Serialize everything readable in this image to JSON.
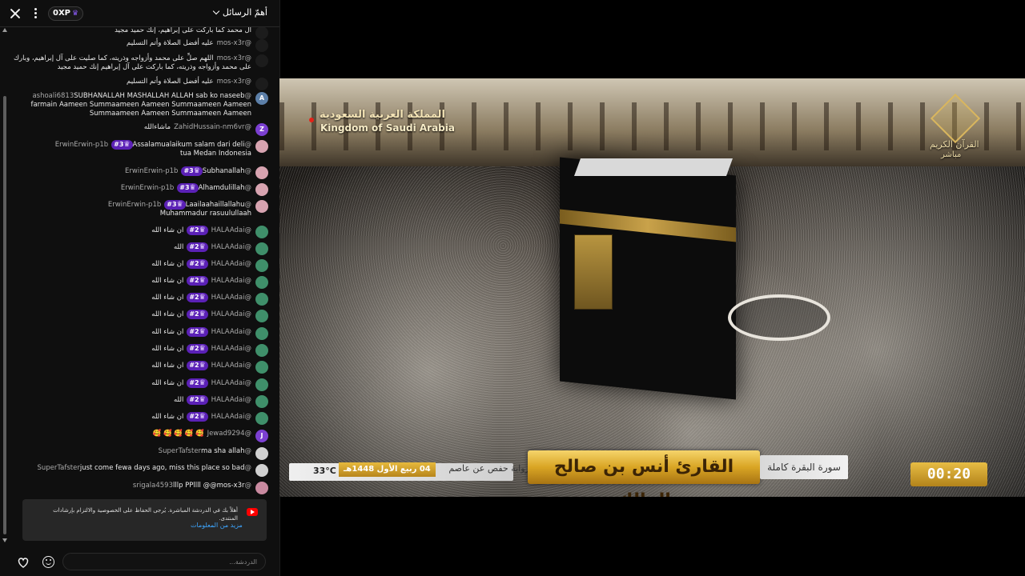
{
  "header": {
    "xp_label": "0XP",
    "mode_label": "أهمّ الرسائل"
  },
  "messages": [
    {
      "author": "",
      "text": "آل محمد كما باركت على إبراهيم، إنك حميد مجيد",
      "avatar_color": "#1c1c1c",
      "avatar_letter": ""
    },
    {
      "author": "@mos-x3r",
      "text": "عليه أفضل الصلاة وأتم التسليم",
      "avatar_color": "#1c1c1c",
      "avatar_letter": ""
    },
    {
      "author": "@mos-x3r",
      "text": "اللهم صلِّ على محمد وأزواجه وذريته، كما صليت على آل إبراهيم، وبارك على محمد وأزواجه وذريته، كما باركت على آل إبراهيم إنك حميد مجيد",
      "avatar_color": "#1c1c1c",
      "avatar_letter": ""
    },
    {
      "author": "@mos-x3r",
      "text": "عليه أفضل الصلاة وأتم التسليم",
      "avatar_color": "#1c1c1c",
      "avatar_letter": ""
    },
    {
      "author": "@ashoali6813",
      "text": "SUBHANALLAH MASHALLAH ALLAH sab ko naseeb farmain Aameen Summaameen Aameen Summaameen Aameen Summaameen Aameen Summaameen Aameen",
      "avatar_color": "#5c7fa8",
      "avatar_letter": "A"
    },
    {
      "author": "@ZahidHussain-nm6vr",
      "text": "ماشاءالله",
      "avatar_color": "#7b3fd1",
      "avatar_letter": "Z"
    },
    {
      "author": "@ErwinErwin-p1b",
      "rank": "#3",
      "text": "Assalamualaikum salam dari deli tua Medan Indonesia",
      "avatar_color": "#d7a3b0",
      "avatar_letter": ""
    },
    {
      "author": "@ErwinErwin-p1b",
      "rank": "#3",
      "text": "Subhanallah",
      "avatar_color": "#d7a3b0",
      "avatar_letter": ""
    },
    {
      "author": "@ErwinErwin-p1b",
      "rank": "#3",
      "text": "Alhamdulillah",
      "avatar_color": "#d7a3b0",
      "avatar_letter": ""
    },
    {
      "author": "@ErwinErwin-p1b",
      "rank": "#3",
      "text": "Laailaahaillallahu Muhammadur rasuulullaah",
      "avatar_color": "#d7a3b0",
      "avatar_letter": ""
    },
    {
      "author": "@HALAAdai",
      "rank": "#2",
      "text": "ان شاء الله",
      "avatar_color": "#3f8f6a",
      "avatar_letter": ""
    },
    {
      "author": "@HALAAdai",
      "rank": "#2",
      "text": "الله",
      "avatar_color": "#3f8f6a",
      "avatar_letter": ""
    },
    {
      "author": "@HALAAdai",
      "rank": "#2",
      "text": "ان شاء الله",
      "avatar_color": "#3f8f6a",
      "avatar_letter": ""
    },
    {
      "author": "@HALAAdai",
      "rank": "#2",
      "text": "ان شاء الله",
      "avatar_color": "#3f8f6a",
      "avatar_letter": ""
    },
    {
      "author": "@HALAAdai",
      "rank": "#2",
      "text": "ان شاء الله",
      "avatar_color": "#3f8f6a",
      "avatar_letter": ""
    },
    {
      "author": "@HALAAdai",
      "rank": "#2",
      "text": "ان شاء الله",
      "avatar_color": "#3f8f6a",
      "avatar_letter": ""
    },
    {
      "author": "@HALAAdai",
      "rank": "#2",
      "text": "ان شاء الله",
      "avatar_color": "#3f8f6a",
      "avatar_letter": ""
    },
    {
      "author": "@HALAAdai",
      "rank": "#2",
      "text": "ان شاء الله",
      "avatar_color": "#3f8f6a",
      "avatar_letter": ""
    },
    {
      "author": "@HALAAdai",
      "rank": "#2",
      "text": "ان شاء الله",
      "avatar_color": "#3f8f6a",
      "avatar_letter": ""
    },
    {
      "author": "@HALAAdai",
      "rank": "#2",
      "text": "ان شاء الله",
      "avatar_color": "#3f8f6a",
      "avatar_letter": ""
    },
    {
      "author": "@HALAAdai",
      "rank": "#2",
      "text": "الله",
      "avatar_color": "#3f8f6a",
      "avatar_letter": ""
    },
    {
      "author": "@HALAAdai",
      "rank": "#2",
      "text": "ان شاء الله",
      "avatar_color": "#3f8f6a",
      "avatar_letter": ""
    },
    {
      "author": "@Jewad9294",
      "text": "🥰 🥰 🥰 🥰 🥰",
      "avatar_color": "#7b3fd1",
      "avatar_letter": "J"
    },
    {
      "author": "@SuperTafster",
      "text": "ma sha allah",
      "avatar_color": "#d0d0d0",
      "avatar_letter": ""
    },
    {
      "author": "@SuperTafster",
      "text": "just come fewa days ago, miss this place so bad",
      "avatar_color": "#d0d0d0",
      "avatar_letter": ""
    },
    {
      "author": "@srigala4593",
      "text": "lllp PPllll @@mos-x3r",
      "avatar_color": "#c98aa0",
      "avatar_letter": ""
    }
  ],
  "banner": {
    "text": "أهلاً بك في الدردشة المباشرة. يُرجى الحفاظ على الخصوصية والالتزام بإرشادات المنتدى.",
    "link": "مزيد من المعلومات"
  },
  "input": {
    "placeholder": "الدردشة..."
  },
  "video": {
    "channel_ar": "المملكة العربية السعودية",
    "channel_en": "Kingdom of Saudi Arabia",
    "logo_line1": "القرآن الكريم",
    "logo_line2": "مباشر",
    "temperature": "33°C",
    "hijri_date": "04 ربيع الأول 1448هـ",
    "riwaya": "برواية حفص عن عاصم",
    "reciter": "القارئ أنس بن صالح المالك",
    "surah": "سورة البقرة كاملة",
    "timer": "00:20"
  }
}
